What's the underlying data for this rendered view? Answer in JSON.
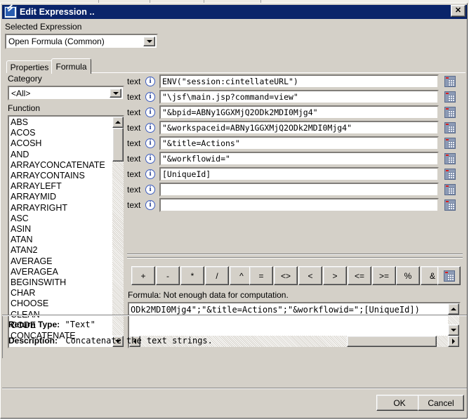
{
  "window": {
    "title": "Edit Expression ..",
    "icon": "edit-expression-icon",
    "close_label": "✕"
  },
  "selected_expression": {
    "label": "Selected Expression",
    "value": "Open Formula (Common)"
  },
  "tabs": [
    {
      "label": "Properties",
      "active": false
    },
    {
      "label": "Formula",
      "active": true
    }
  ],
  "category": {
    "label": "Category",
    "value": "<All>"
  },
  "function_list": {
    "label": "Function",
    "items": [
      "ABS",
      "ACOS",
      "ACOSH",
      "AND",
      "ARRAYCONCATENATE",
      "ARRAYCONTAINS",
      "ARRAYLEFT",
      "ARRAYMID",
      "ARRAYRIGHT",
      "ASC",
      "ASIN",
      "ATAN",
      "ATAN2",
      "AVERAGE",
      "AVERAGEA",
      "BEGINSWITH",
      "CHAR",
      "CHOOSE",
      "CLEAN",
      "CODE",
      "CONCATENATE"
    ]
  },
  "arguments": {
    "type_label": "text",
    "info_glyph": "i",
    "rows": [
      {
        "value": "ENV(\"session:cintellateURL\")"
      },
      {
        "value": "\"\\jsf\\main.jsp?command=view\""
      },
      {
        "value": "\"&bpid=ABNy1GGXMjQ2ODk2MDI0Mjg4\""
      },
      {
        "value": "\"&workspaceid=ABNy1GGXMjQ2ODk2MDI0Mjg4\""
      },
      {
        "value": "\"&title=Actions\""
      },
      {
        "value": "\"&workflowid=\""
      },
      {
        "value": "[UniqueId]"
      },
      {
        "value": ""
      },
      {
        "value": ""
      }
    ]
  },
  "operators": {
    "group_arith": [
      "+",
      "-",
      "*",
      "/",
      "^"
    ],
    "group_compare": [
      "=",
      "<>",
      "<",
      ">",
      "<=",
      ">="
    ],
    "group_misc": [
      "%",
      "&"
    ],
    "grid_button": "grid-icon"
  },
  "formula": {
    "label": "Formula: Not enough data for computation.",
    "value": "ODk2MDI0Mjg4\";\"&title=Actions\";\"&workflowid=\";[UniqueId])"
  },
  "status": {
    "return_type_label": "Return Type:",
    "return_type_value": "\"Text\"",
    "description_label": "Description:",
    "description_value": "Concatenate the text strings."
  },
  "dialog_buttons": {
    "ok": "OK",
    "cancel": "Cancel"
  },
  "colors": {
    "titlebar": "#0a246a",
    "dialog_face": "#d4d0c8",
    "field_bg": "#ffffff",
    "info_icon_blue": "#3b5bbf"
  }
}
